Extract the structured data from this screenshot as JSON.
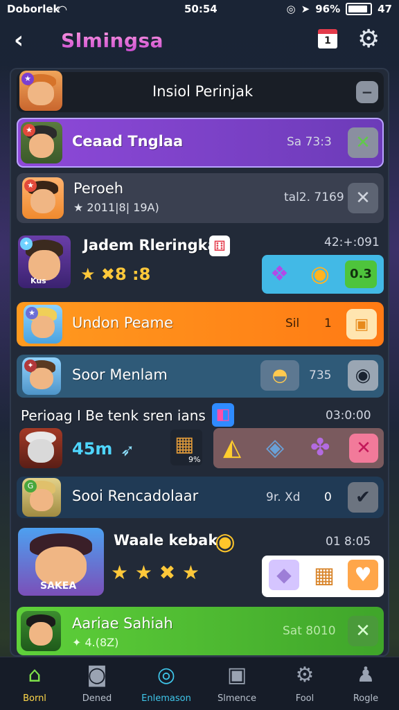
{
  "status": {
    "carrier": "Doborlek",
    "time": "50:54",
    "battery": "96%",
    "extra": "47"
  },
  "appbar": {
    "title": "Slmingsa",
    "calendar_day": "1"
  },
  "header_row": {
    "title": "Insiol Perinjak"
  },
  "rows": [
    {
      "name": "Ceaad Tnglaa",
      "value": "Sa 73:3"
    },
    {
      "name": "Peroeh",
      "sub": "★ 2011|8| 19A)",
      "value": "tal2. 7169"
    },
    {
      "name": "Jadem Rleringkat",
      "stars": "★ ✖8 :8",
      "value": "42:+:091",
      "avatar_tag": "Kus",
      "button": "0.3"
    },
    {
      "name": "Undon Peame",
      "value": "Sil",
      "value2": "1"
    },
    {
      "name": "Soor Menlam",
      "value": "735"
    },
    {
      "name": "Perioag I Be tenk sren ians",
      "value": "03:0:00",
      "score": "45m",
      "box_tag": "9%"
    },
    {
      "name": "Sooi Rencadolaar",
      "value": "9r. Xd",
      "value2": "0"
    },
    {
      "name": "Waale kebak",
      "stars": "★ ★ ✖ ★",
      "value": "01 8:05",
      "avatar_tag": "SAKEA"
    },
    {
      "name": "Aariae Sahiah",
      "sub": "✦ 4.(8Z)",
      "value": "Sat 8010"
    }
  ],
  "tabs": [
    {
      "label": "Bornl",
      "icon": "home-icon"
    },
    {
      "label": "Dened",
      "icon": "camera-icon"
    },
    {
      "label": "Enlemason",
      "icon": "search-icon"
    },
    {
      "label": "Slmence",
      "icon": "chat-icon"
    },
    {
      "label": "Fool",
      "icon": "settings-icon"
    },
    {
      "label": "Rogle",
      "icon": "profile-icon"
    }
  ],
  "colors": {
    "purple": "#7b3fd0",
    "orange": "#ff8a1c",
    "green": "#59c22a",
    "cyan": "#3fc6ea"
  }
}
